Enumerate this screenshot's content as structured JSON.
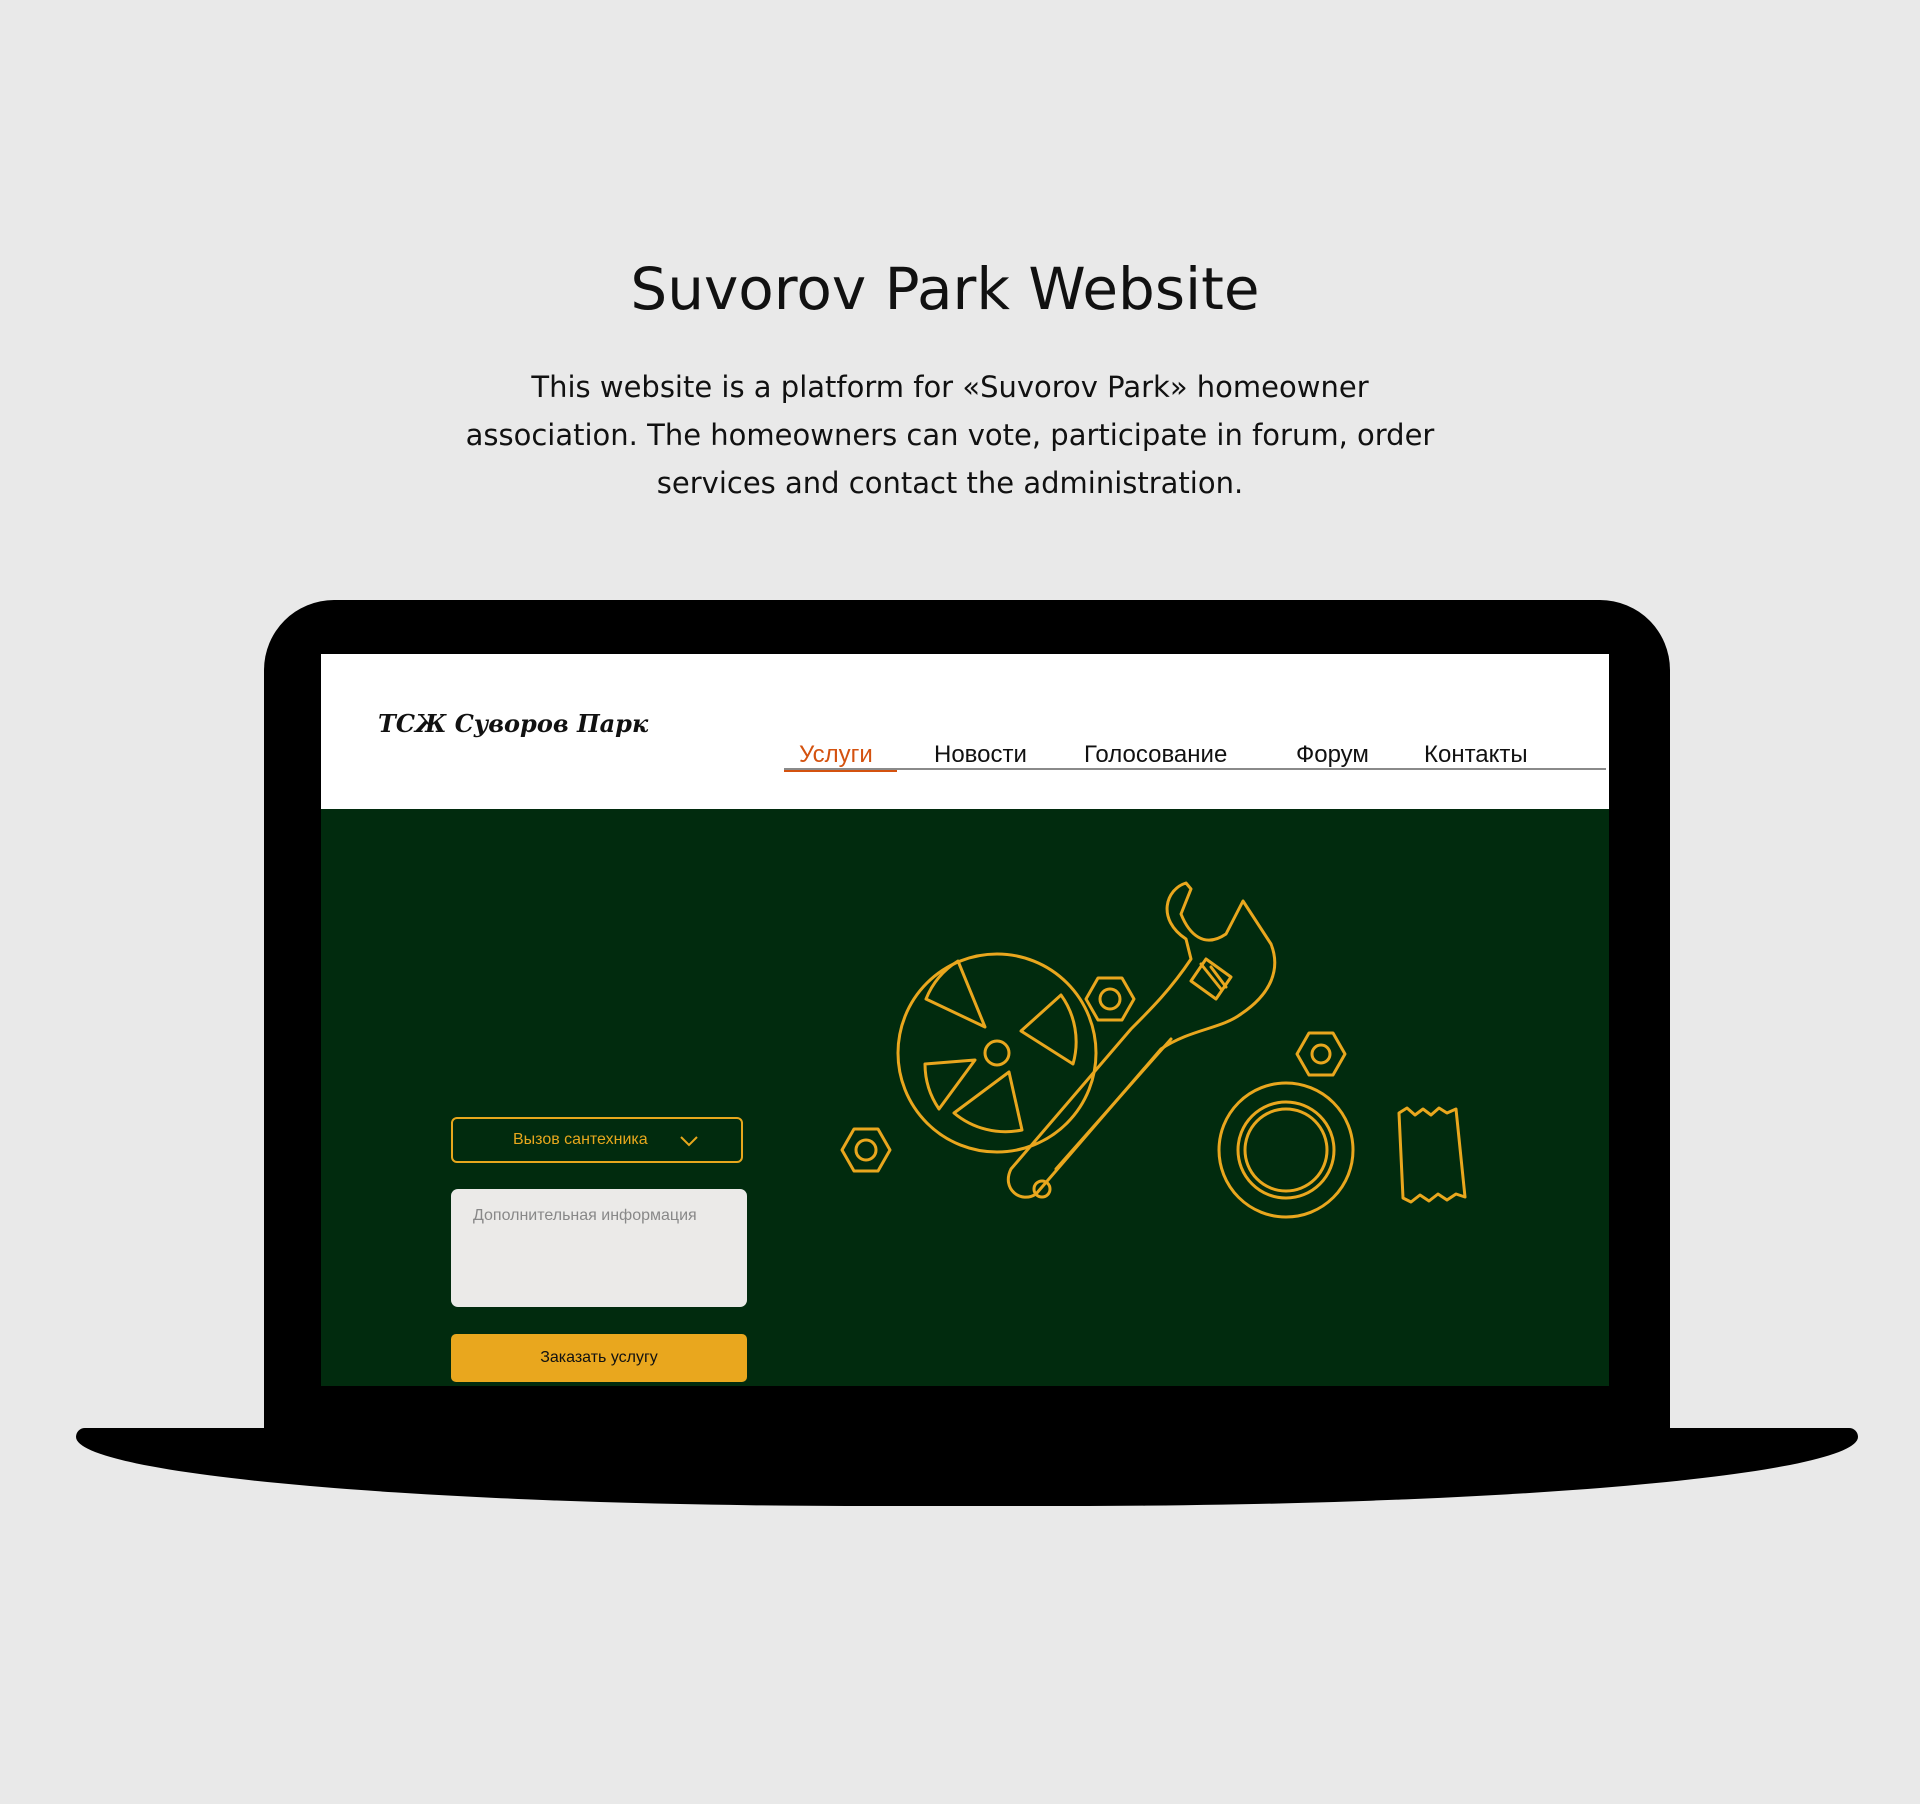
{
  "title": "Suvorov Park Website",
  "description": "This website is a platform for «Suvorov Park» homeowner association. The homeowners can vote, participate in forum, order services and contact the administration.",
  "site": {
    "logo": "ТСЖ Суворов Парк",
    "nav": [
      {
        "label": "Услуги",
        "active": true
      },
      {
        "label": "Новости",
        "active": false
      },
      {
        "label": "Голосование",
        "active": false
      },
      {
        "label": "Форум",
        "active": false
      },
      {
        "label": "Контакты",
        "active": false
      }
    ],
    "form": {
      "service_select": "Вызов сантехника",
      "info_placeholder": "Дополнительная информация",
      "submit_label": "Заказать услугу"
    },
    "illustration_icons": [
      "gear-icon",
      "wrench-icon",
      "hex-nut-icon",
      "washer-icon",
      "tape-icon"
    ]
  },
  "colors": {
    "background": "#e9e9e9",
    "hero": "#012b0e",
    "accent": "#e9a71e",
    "active_nav": "#d4520f"
  }
}
